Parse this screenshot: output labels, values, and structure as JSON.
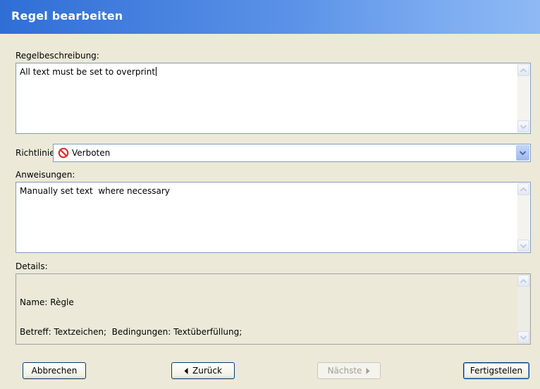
{
  "window": {
    "title": "Regel bearbeiten"
  },
  "description": {
    "label": "Regelbeschreibung:",
    "value": "All text must be set to overprint"
  },
  "guideline": {
    "label": "Richtlinie:",
    "selected": "Verboten",
    "icon": "prohibited-icon"
  },
  "instructions": {
    "label": "Anweisungen:",
    "value": "Manually set text  where necessary"
  },
  "details": {
    "label": "Details:",
    "line1": "Name: Règle",
    "line2": "Betreff: Textzeichen;  Bedingungen: Textüberfüllung;"
  },
  "buttons": {
    "cancel": "Abbrechen",
    "back": "Zurück",
    "next": "Nächste",
    "finish": "Fertigstellen"
  },
  "colors": {
    "titlebar": "#2F6ED6",
    "dialog_bg": "#ECE9D8",
    "field_border": "#7F9DB9",
    "prohibited": "#E03030"
  }
}
